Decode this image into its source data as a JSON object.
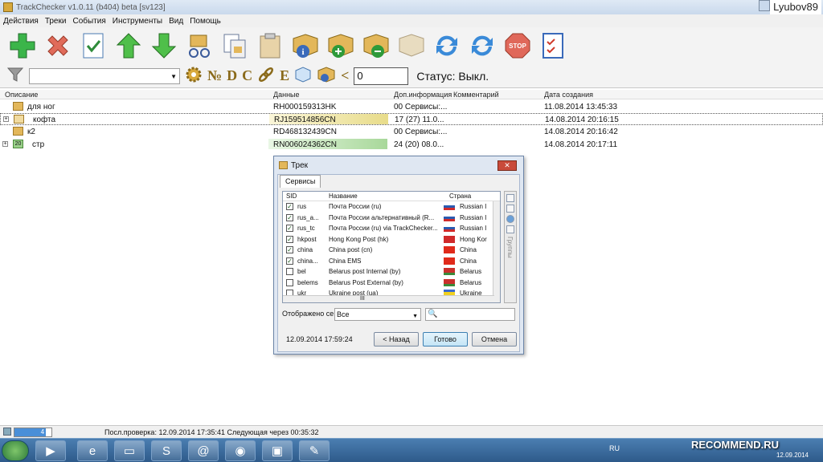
{
  "window": {
    "title": "TrackChecker v1.0.11 (b404) beta [sv123]",
    "user": "Lyubov89"
  },
  "menu": [
    "Действия",
    "Треки",
    "События",
    "Инструменты",
    "Вид",
    "Помощь"
  ],
  "toolbar2": {
    "filter_value": "",
    "sym_no": "№",
    "sym_d": "D",
    "sym_c": "C",
    "sym_e": "E",
    "sym_lt": "<",
    "number_value": "0",
    "status": "Статус: Выкл."
  },
  "grid": {
    "headers": [
      "Описание",
      "Данные",
      "Доп.информация",
      "Комментарий",
      "Дата создания"
    ],
    "rows": [
      {
        "desc": "для ног",
        "data": "RH000159313HK",
        "info": "00 Сервисы:...",
        "comment": "",
        "date": "11.08.2014 13:45:33",
        "expand": ""
      },
      {
        "desc": "кофта",
        "data": "RJ159514856CN",
        "info": "17 (27) 11.0...",
        "comment": "",
        "date": "14.08.2014 20:16:15",
        "expand": "+"
      },
      {
        "desc": "к2",
        "data": "RD468132439CN",
        "info": "00 Сервисы:...",
        "comment": "",
        "date": "14.08.2014 20:16:42",
        "expand": ""
      },
      {
        "desc": "стр",
        "data": "RN006024362CN",
        "info": "24 (20) 08.0...",
        "comment": "",
        "date": "14.08.2014 20:17:11",
        "expand": "+"
      }
    ],
    "badge_20": "20"
  },
  "dialog": {
    "title": "Трек",
    "tab": "Сервисы",
    "list_headers": [
      "SID",
      "Название",
      "Страна"
    ],
    "services": [
      {
        "sid": "rus",
        "name": "Почта России (ru)",
        "country": "Russian I",
        "checked": true,
        "flag": "ru"
      },
      {
        "sid": "rus_a...",
        "name": "Почта России альтернативный (R...",
        "country": "Russian I",
        "checked": true,
        "flag": "ru"
      },
      {
        "sid": "rus_tc",
        "name": "Почта России (ru) via TrackChecker...",
        "country": "Russian I",
        "checked": true,
        "flag": "ru"
      },
      {
        "sid": "hkpost",
        "name": "Hong Kong Post (hk)",
        "country": "Hong Kor",
        "checked": true,
        "flag": "hk"
      },
      {
        "sid": "china",
        "name": "China post (cn)",
        "country": "China",
        "checked": true,
        "flag": "cn"
      },
      {
        "sid": "china...",
        "name": "China EMS",
        "country": "China",
        "checked": true,
        "flag": "cn"
      },
      {
        "sid": "bel",
        "name": "Belarus post Internal (by)",
        "country": "Belarus",
        "checked": false,
        "flag": "by"
      },
      {
        "sid": "belems",
        "name": "Belarus Post External (by)",
        "country": "Belarus",
        "checked": false,
        "flag": "by"
      },
      {
        "sid": "ukr",
        "name": "Ukraine post (ua)",
        "country": "Ukraine",
        "checked": false,
        "flag": "ua"
      }
    ],
    "groups_label": "Группы",
    "display_label": "Отображено се",
    "display_value": "Все",
    "search_value": "",
    "timestamp": "12.09.2014 17:59:24",
    "back_button": "< Назад",
    "done_button": "Готово",
    "cancel_button": "Отмена",
    "hscroll_mark": "III"
  },
  "statusbar": {
    "progress_value": "4",
    "progress_fraction": 0.85,
    "text": "Посл.проверка: 12.09.2014 17:35:41 Следующая через 00:35:32"
  },
  "taskbar": {
    "lang": "RU",
    "watermark": "RECOMMEND.RU",
    "date": "12.09.2014"
  },
  "colors": {
    "row_highlight_yellow": "#f5edb0",
    "row_highlight_green": "#c7ebc0",
    "accent_blue": "#3c7fb1"
  }
}
